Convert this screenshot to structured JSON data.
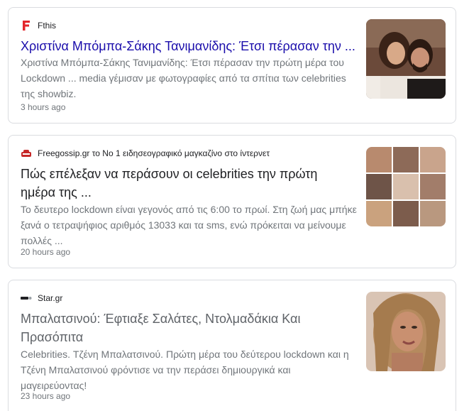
{
  "results": [
    {
      "source": "Fthis",
      "logo_icon": "fthis-f-logo-icon",
      "logo_color": "#e3262b",
      "title": "Χριστίνα Μπόμπα-Σάκης Τανιμανίδης: Έτσι πέρασαν την ...",
      "snippet": "Χριστίνα Μπόμπα-Σάκης Τανιμανίδης: Έτσι πέρασαν την πρώτη μέρα του Lockdown ... media γέμισαν με φωτογραφίες από τα σπίτια των celebrities της showbiz.",
      "time": "3 hours ago",
      "thumbnail": "couple-selfie-thumbnail"
    },
    {
      "source": "Freegossip.gr το No 1 ειδησεογραφικό μαγκαζίνο στο ίντερνετ",
      "logo_icon": "freegossip-logo-icon",
      "logo_color": "#c62828",
      "title": "Πώς επέλεξαν να περάσουν οι celebrities την πρώτη ημέρα της ...",
      "snippet": "Το δευτερο lockdown είναι γεγονός από τις 6:00 το πρωί. Στη ζωή μας μπήκε ξανά ο τετραψήφιος αριθμός 13033 και τα sms, ενώ πρόκειται να μείνουμε πολλές ...",
      "time": "20 hours ago",
      "thumbnail": "celebrity-collage-thumbnail"
    },
    {
      "source": "Star.gr",
      "logo_icon": "star-gr-logo-icon",
      "title": "Μπαλατσινού: Έφτιαξε Σαλάτες, Ντολμαδάκια Και Πρασόπιτα",
      "snippet": "Celebrities. Τζένη Μπαλατσινού. Πρώτη μέρα του δεύτερου lockdown και η Τζένη Μπαλατσινού φρόντισε να την περάσει δημιουργικά και μαγειρεύοντας!",
      "time": "23 hours ago",
      "thumbnail": "woman-portrait-thumbnail"
    }
  ]
}
